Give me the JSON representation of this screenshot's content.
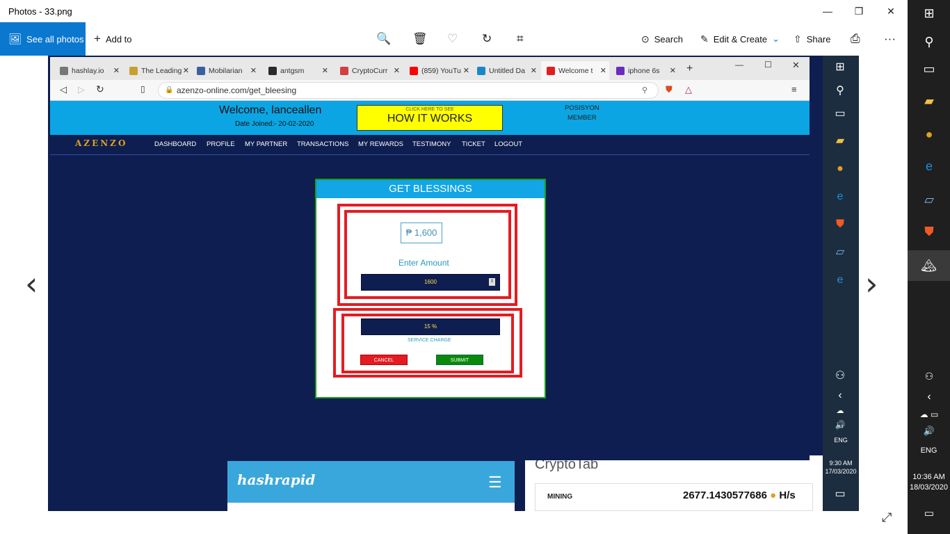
{
  "photos": {
    "title": "Photos - 33.png",
    "see_all": "See all photos",
    "add_to": "Add to",
    "search": "Search",
    "edit_create": "Edit & Create",
    "share": "Share",
    "icons": [
      "zoom-icon",
      "delete-icon",
      "heart-icon",
      "rotate-icon",
      "crop-icon",
      "print-icon",
      "more-icon"
    ]
  },
  "browser": {
    "tabs": [
      {
        "label": "hashlay.io",
        "icon_color": "#777777"
      },
      {
        "label": "The Leading",
        "icon_color": "#c8a030"
      },
      {
        "label": "Mobilarian",
        "icon_color": "#3a5fa0"
      },
      {
        "label": "antgsm",
        "icon_color": "#2a2a2a"
      },
      {
        "label": "CryptoCurr",
        "icon_color": "#d04040"
      },
      {
        "label": "(859) YouTu",
        "icon_color": "#ff0000"
      },
      {
        "label": "Untitled Da",
        "icon_color": "#1a88c8"
      },
      {
        "label": "Welcome t",
        "icon_color": "#e02020"
      },
      {
        "label": "iphone 6s",
        "icon_color": "#6a2cc0"
      }
    ],
    "url": "azenzo-online.com/get_bleesing"
  },
  "site": {
    "welcome": "Welcome, lanceallen",
    "date_joined": "Date Joined:- 20-02-2020",
    "hiw_small": "CLICK HERE TO SEE",
    "hiw_big": "HOW IT WORKS",
    "posisyon": "POSISYON",
    "member": "MEMBER",
    "logo": "AZENZO",
    "nav": [
      "DASHBOARD",
      "PROFILE",
      "MY PARTNER",
      "TRANSACTIONS",
      "MY REWARDS",
      "TESTIMONY",
      "TICKET",
      "LOGOUT"
    ]
  },
  "modal": {
    "title": "GET BLESSINGS",
    "amount_display": "₱ 1,600",
    "enter_amount": "Enter Amount",
    "amount_value": "1600",
    "charge_value": "15 %",
    "charge_label": "SERVICE CHARGE",
    "cancel": "CANCEL",
    "submit": "SUBMIT"
  },
  "background": {
    "hashrapid": "hashrapid",
    "cryptotab": "CryptoTab",
    "mining_label": "MINING",
    "mining_value": "2677.1430577686",
    "mining_unit": "H/s"
  },
  "inner_taskbar": {
    "lang": "ENG",
    "time": "9:30 AM",
    "date": "17/03/2020"
  },
  "taskbar": {
    "lang": "ENG",
    "time": "10:36 AM",
    "date": "18/03/2020"
  }
}
